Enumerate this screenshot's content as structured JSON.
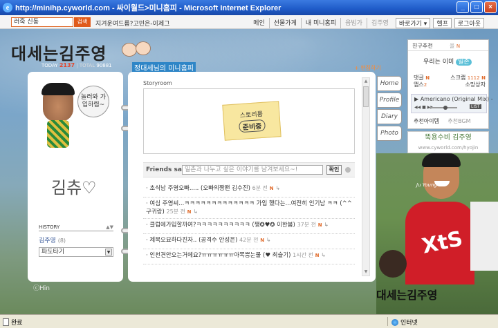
{
  "window": {
    "title": "http://minihp.cyworld.com - 싸이월드>미니홈피 - Microsoft Internet Explorer",
    "minimize": "_",
    "maximize": "□",
    "close": "×"
  },
  "topnav": {
    "search_value": "러죽 신동",
    "search_button": "검색",
    "promo": "지겨운여드름?고민은-이제그",
    "menu": [
      "메인",
      "선물가게",
      "내 미니홈피",
      "음빔가",
      "김주영",
      "바로가기 ▾",
      "헬프",
      "로그아웃"
    ]
  },
  "header": {
    "logo": "대세는김주영",
    "today_label": "TODAY",
    "today_count": "2137",
    "total_label": "TOTAL",
    "total_count": "90881",
    "minihp_title": "정대세님의 미니홈피",
    "edit_link": "+ 편집하기"
  },
  "profile": {
    "bubble_text": "놀러와 가입하렴~",
    "signature": "김츄♡",
    "history_label": "HISTORY",
    "history_name": "김주영",
    "history_count": "(8)",
    "dropdown_value": "파도타기"
  },
  "copyright": "ⓒHin",
  "storyroom": {
    "label": "Storyroom",
    "note_line1": "스토리룸",
    "note_line2": "준비중"
  },
  "friends_say": {
    "label": "Friends say",
    "placeholder": "일촌과 나누고 싶은 이야기를 남겨보세요~!",
    "ok_button": "확인"
  },
  "comments": [
    {
      "text": "· 초식남 주영오빠..... (오빠의짱팬 김수진)",
      "time": "6분 전"
    },
    {
      "text": "· 여심 주영씨...ㅋㅋㅋㅋㅋㅋㅋㅋㅋㅋㅋㅋㅋ 가입 했다는...여전히 인기남 ㅋㅋ (^^ 구귀랑)",
      "time": "25분 전"
    },
    {
      "text": "· 클럽에가입할까여?ㅋㅋㅋㅋㅋㅋㅋㅋㅋㅋ (쨍✪♥✪ 이한봄)",
      "time": "37분 전"
    },
    {
      "text": "· 제목오묘하다진자.. (공격수 안성은)",
      "time": "42분 전"
    },
    {
      "text": "· 인천견안오는거에요?ㅠㅠㅠㅠㅠㅠ아쪽뿡눈물 (♥ 최슬기)",
      "time": "1시간 전"
    }
  ],
  "side_tabs": [
    "Home",
    "Profile",
    "Diary",
    "Photo"
  ],
  "right_panel": {
    "tab1": "친구추천",
    "tab2": "올",
    "tab2_badge": "N",
    "circle_text": "우리는 이미",
    "circle_tag": "일촌",
    "stats": [
      {
        "label": "댓글",
        "badge": "N",
        "label2": "스크랩",
        "value2": "1112",
        "badge2": "N"
      },
      {
        "label": "앱스",
        "value": "2",
        "label2": "소망상자",
        "value2": ""
      }
    ],
    "player_track": "Americano (Original Mix) -",
    "player_list": "LIST",
    "bgm_label": "추천아이템",
    "bgm_muted": "추천BGM"
  },
  "banner": {
    "text": "뚝용수비 김주영",
    "sub": "www.cyworld.com/hyojin"
  },
  "photo": {
    "caption": "Ju Young",
    "jersey": "XtS",
    "signature": "대세는김주영"
  },
  "statusbar": {
    "left": "완료",
    "right": "인터넷"
  }
}
